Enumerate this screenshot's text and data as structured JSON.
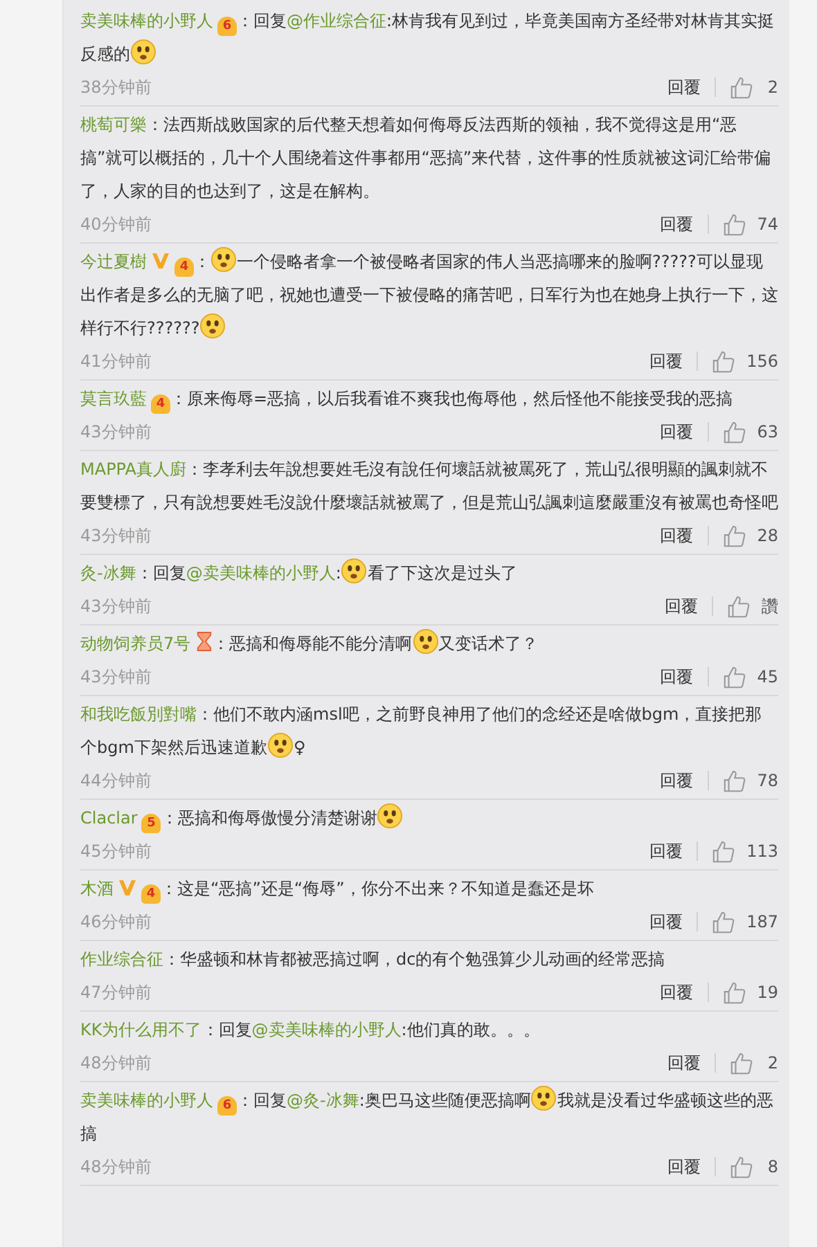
{
  "comments": [
    {
      "author": "卖美味棒的小野人",
      "badges": [
        {
          "kind": "level",
          "level": "6"
        }
      ],
      "content": [
        {
          "kind": "text",
          "text": "：回复"
        },
        {
          "kind": "mention",
          "text": "@作业综合征"
        },
        {
          "kind": "text",
          "text": ":林肯我有见到过，毕竟美国南方圣经带对林肯其实挺反感的"
        },
        {
          "kind": "emoji"
        }
      ],
      "time": "38分钟前",
      "reply": "回覆",
      "likes": "2"
    },
    {
      "author": "桃萄可樂",
      "content": [
        {
          "kind": "text",
          "text": "：法西斯战败国家的后代整天想着如何侮辱反法西斯的领袖，我不觉得这是用“恶搞”就可以概括的，几十个人围绕着这件事都用“恶搞”来代替，这件事的性质就被这词汇给带偏了，人家的目的也达到了，这是在解构。"
        }
      ],
      "time": "40分钟前",
      "reply": "回覆",
      "likes": "74"
    },
    {
      "author": "今辻夏樹",
      "badges": [
        {
          "kind": "vip"
        },
        {
          "kind": "level",
          "level": "4"
        }
      ],
      "content": [
        {
          "kind": "text",
          "text": "："
        },
        {
          "kind": "emoji"
        },
        {
          "kind": "text",
          "text": "一个侵略者拿一个被侵略者国家的伟人当恶搞哪来的脸啊?????可以显现出作者是多么的无脑了吧，祝她也遭受一下被侵略的痛苦吧，日军行为也在她身上执行一下，这样行不行??????"
        },
        {
          "kind": "emoji"
        }
      ],
      "time": "41分钟前",
      "reply": "回覆",
      "likes": "156"
    },
    {
      "author": "莫言玖藍",
      "badges": [
        {
          "kind": "level",
          "level": "4"
        }
      ],
      "content": [
        {
          "kind": "text",
          "text": "：原来侮辱=恶搞，以后我看谁不爽我也侮辱他，然后怪他不能接受我的恶搞"
        }
      ],
      "time": "43分钟前",
      "reply": "回覆",
      "likes": "63"
    },
    {
      "author": "MAPPA真人廚",
      "content": [
        {
          "kind": "text",
          "text": "：李孝利去年說想要姓毛沒有說任何壞話就被罵死了，荒山弘很明顯的諷刺就不要雙標了，只有說想要姓毛沒說什麼壞話就被罵了，但是荒山弘諷刺這麼嚴重沒有被罵也奇怪吧"
        }
      ],
      "time": "43分钟前",
      "reply": "回覆",
      "likes": "28"
    },
    {
      "author": "灸-冰舞",
      "content": [
        {
          "kind": "text",
          "text": "：回复"
        },
        {
          "kind": "mention",
          "text": "@卖美味棒的小野人"
        },
        {
          "kind": "text",
          "text": ":"
        },
        {
          "kind": "emoji"
        },
        {
          "kind": "text",
          "text": "看了下这次是过头了"
        }
      ],
      "time": "43分钟前",
      "reply": "回覆",
      "likes": "讚"
    },
    {
      "author": "动物饲养员7号",
      "badges": [
        {
          "kind": "hourglass"
        }
      ],
      "content": [
        {
          "kind": "text",
          "text": "：恶搞和侮辱能不能分清啊"
        },
        {
          "kind": "emoji"
        },
        {
          "kind": "text",
          "text": "又变话术了？"
        }
      ],
      "time": "43分钟前",
      "reply": "回覆",
      "likes": "45"
    },
    {
      "author": "和我吃飯別對嘴",
      "content": [
        {
          "kind": "text",
          "text": "：他们不敢内涵msl吧，之前野良神用了他们的念经还是啥做bgm，直接把那个bgm下架然后迅速道歉"
        },
        {
          "kind": "emoji"
        },
        {
          "kind": "text",
          "text": "♀"
        }
      ],
      "time": "44分钟前",
      "reply": "回覆",
      "likes": "78"
    },
    {
      "author": "Claclar",
      "badges": [
        {
          "kind": "level",
          "level": "5"
        }
      ],
      "content": [
        {
          "kind": "text",
          "text": "：恶搞和侮辱傲慢分清楚谢谢"
        },
        {
          "kind": "emoji"
        }
      ],
      "time": "45分钟前",
      "reply": "回覆",
      "likes": "113"
    },
    {
      "author": "木酒",
      "badges": [
        {
          "kind": "vip"
        },
        {
          "kind": "level",
          "level": "4"
        }
      ],
      "content": [
        {
          "kind": "text",
          "text": "：这是“恶搞”还是“侮辱”，你分不出来？不知道是蠢还是坏"
        }
      ],
      "time": "46分钟前",
      "reply": "回覆",
      "likes": "187"
    },
    {
      "author": "作业综合征",
      "content": [
        {
          "kind": "text",
          "text": "：华盛顿和林肯都被恶搞过啊，dc的有个勉强算少儿动画的经常恶搞"
        }
      ],
      "time": "47分钟前",
      "reply": "回覆",
      "likes": "19"
    },
    {
      "author": "KK为什么用不了",
      "content": [
        {
          "kind": "text",
          "text": "：回复"
        },
        {
          "kind": "mention",
          "text": "@卖美味棒的小野人"
        },
        {
          "kind": "text",
          "text": ":他们真的敢。。。"
        }
      ],
      "time": "48分钟前",
      "reply": "回覆",
      "likes": "2"
    },
    {
      "author": "卖美味棒的小野人",
      "badges": [
        {
          "kind": "level",
          "level": "6"
        }
      ],
      "content": [
        {
          "kind": "text",
          "text": "：回复"
        },
        {
          "kind": "mention",
          "text": "@灸-冰舞"
        },
        {
          "kind": "text",
          "text": ":奥巴马这些随便恶搞啊"
        },
        {
          "kind": "emoji"
        },
        {
          "kind": "text",
          "text": "我就是没看过华盛顿这些的恶搞"
        }
      ],
      "time": "48分钟前",
      "reply": "回覆",
      "likes": "8"
    }
  ]
}
